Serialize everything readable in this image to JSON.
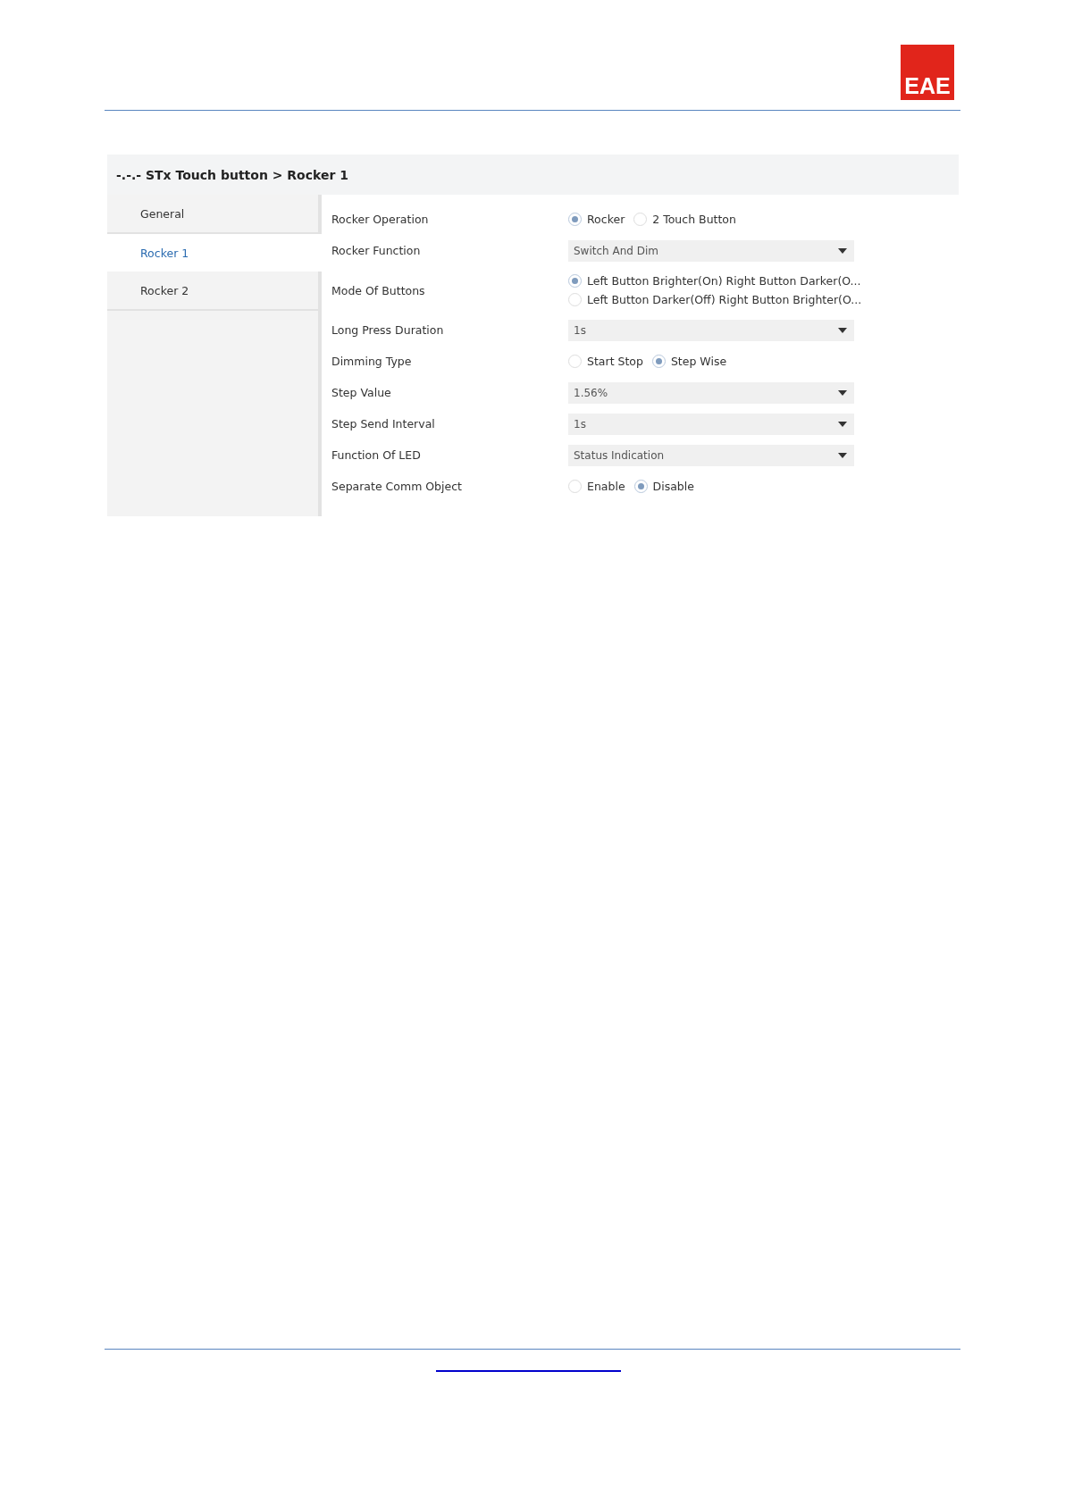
{
  "logo": {
    "text": "EAE"
  },
  "window": {
    "title": "-.-.- STx Touch button > Rocker 1"
  },
  "sidebar": {
    "items": [
      {
        "label": "General",
        "selected": false
      },
      {
        "label": "Rocker 1",
        "selected": true
      },
      {
        "label": "Rocker 2",
        "selected": false
      }
    ]
  },
  "parameters": [
    {
      "kind": "radio",
      "label": "Rocker Operation",
      "options": [
        {
          "label": "Rocker",
          "selected": true
        },
        {
          "label": "2 Touch Button",
          "selected": false
        }
      ]
    },
    {
      "kind": "dropdown",
      "label": "Rocker Function",
      "value": "Switch And Dim"
    },
    {
      "kind": "stack",
      "label": "Mode Of Buttons",
      "options": [
        {
          "label": "Left Button Brighter(On) Right Button Darker(O...",
          "selected": true
        },
        {
          "label": "Left Button Darker(Off) Right Button Brighter(O...",
          "selected": false
        }
      ]
    },
    {
      "kind": "dropdown",
      "label": "Long Press Duration",
      "value": "1s"
    },
    {
      "kind": "radio",
      "label": "Dimming Type",
      "options": [
        {
          "label": "Start Stop",
          "selected": false
        },
        {
          "label": "Step Wise",
          "selected": true
        }
      ]
    },
    {
      "kind": "dropdown",
      "label": "Step Value",
      "value": "1.56%"
    },
    {
      "kind": "dropdown",
      "label": "Step Send Interval",
      "value": "1s"
    },
    {
      "kind": "dropdown",
      "label": "Function Of LED",
      "value": "Status Indication"
    },
    {
      "kind": "radio",
      "label": "Separate Comm Object",
      "options": [
        {
          "label": "Enable",
          "selected": false
        },
        {
          "label": "Disable",
          "selected": true
        }
      ]
    }
  ],
  "footer": {
    "link": {
      "kind": "underline"
    }
  }
}
